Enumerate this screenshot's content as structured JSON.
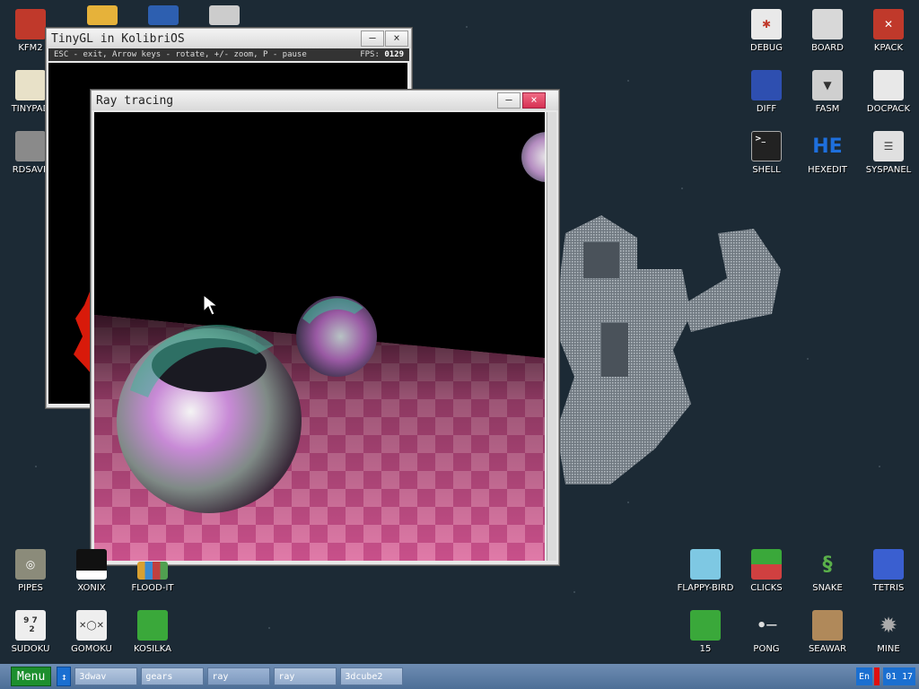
{
  "desktop": {
    "icons_left": [
      {
        "label": "KFM2",
        "icon": "floppy-icon",
        "color": "#c0392b"
      },
      {
        "label": "TINYPAD",
        "icon": "notepad-icon",
        "color": "#e8e1c8"
      },
      {
        "label": "RDSAVE",
        "icon": "ramdisk-icon",
        "color": "#8a8a8a"
      }
    ],
    "icons_top_partial": [
      {
        "icon": "folder-icon",
        "color": "#e6b23a"
      },
      {
        "icon": "monitor-icon",
        "color": "#2d5fb0"
      },
      {
        "icon": "calculator-icon",
        "color": "#cccccc"
      }
    ],
    "icons_right": [
      {
        "label": "DEBUG",
        "icon": "bug-icon",
        "color": "#e9e9e9"
      },
      {
        "label": "BOARD",
        "icon": "board-icon",
        "color": "#d8d8d8"
      },
      {
        "label": "KPACK",
        "icon": "wrench-icon",
        "color": "#c0392b"
      },
      {
        "label": "DIFF",
        "icon": "diff-icon",
        "color": "#2e4fb0"
      },
      {
        "label": "FASM",
        "icon": "fasm-icon",
        "color": "#cfcfcf"
      },
      {
        "label": "DOCPACK",
        "icon": "cabinet-icon",
        "color": "#e8e8e8"
      },
      {
        "label": "SHELL",
        "icon": "terminal-icon",
        "color": "#222222"
      },
      {
        "label": "HEXEDIT",
        "icon": "hex-icon",
        "color": "#1e6fdc",
        "text": "HE"
      },
      {
        "label": "SYSPANEL",
        "icon": "sliders-icon",
        "color": "#e0e0e0"
      }
    ],
    "icons_bottom_left": [
      {
        "label": "PIPES",
        "icon": "pipes-icon",
        "color": "#8b8b7a"
      },
      {
        "label": "XONIX",
        "icon": "xonix-icon",
        "color": "#ffffff"
      },
      {
        "label": "FLOOD-IT",
        "icon": "flood-icon",
        "color": "#d9a030"
      },
      {
        "label": "SUDOKU",
        "icon": "sudoku-icon",
        "color": "#eeeeee",
        "text": "9 7\n 2"
      },
      {
        "label": "GOMOKU",
        "icon": "gomoku-icon",
        "color": "#eeeeee"
      },
      {
        "label": "KOSILKA",
        "icon": "lawnmower-icon",
        "color": "#3aa83a"
      }
    ],
    "icons_bottom_right": [
      {
        "label": "FLAPPY-BIRD",
        "icon": "bird-icon",
        "color": "#7ec8e3"
      },
      {
        "label": "CLICKS",
        "icon": "clicks-icon",
        "color": "#3aa83a"
      },
      {
        "label": "SNAKE",
        "icon": "snake-icon",
        "color": "#5ab04a"
      },
      {
        "label": "TETRIS",
        "icon": "tetris-icon",
        "color": "#3a5fd0"
      },
      {
        "label": "15",
        "icon": "fifteen-icon",
        "color": "#3aa83a"
      },
      {
        "label": "PONG",
        "icon": "pong-icon",
        "color": "#dddddd"
      },
      {
        "label": "SEAWAR",
        "icon": "ship-icon",
        "color": "#b0895a"
      },
      {
        "label": "MINE",
        "icon": "mine-icon",
        "color": "#888888"
      }
    ]
  },
  "windows": {
    "tinygl": {
      "title": "TinyGL in KolibriOS",
      "status": "ESC - exit, Arrow keys - rotate, +/- zoom, P - pause",
      "fps_label": "FPS:",
      "fps_value": "0129",
      "min_label": "–",
      "close_label": "×"
    },
    "ray": {
      "title": "Ray tracing",
      "min_label": "–",
      "close_label": "×"
    }
  },
  "taskbar": {
    "menu_label": "Menu",
    "arrow_label": "↕",
    "tasks": [
      "3dwav",
      "gears",
      "ray",
      "ray",
      "3dcube2"
    ],
    "lang": "En",
    "clock": "01 17"
  },
  "colors": {
    "taskbar": "#5a7ca6",
    "menu": "#1d8f2e",
    "close": "#e03a5a"
  }
}
